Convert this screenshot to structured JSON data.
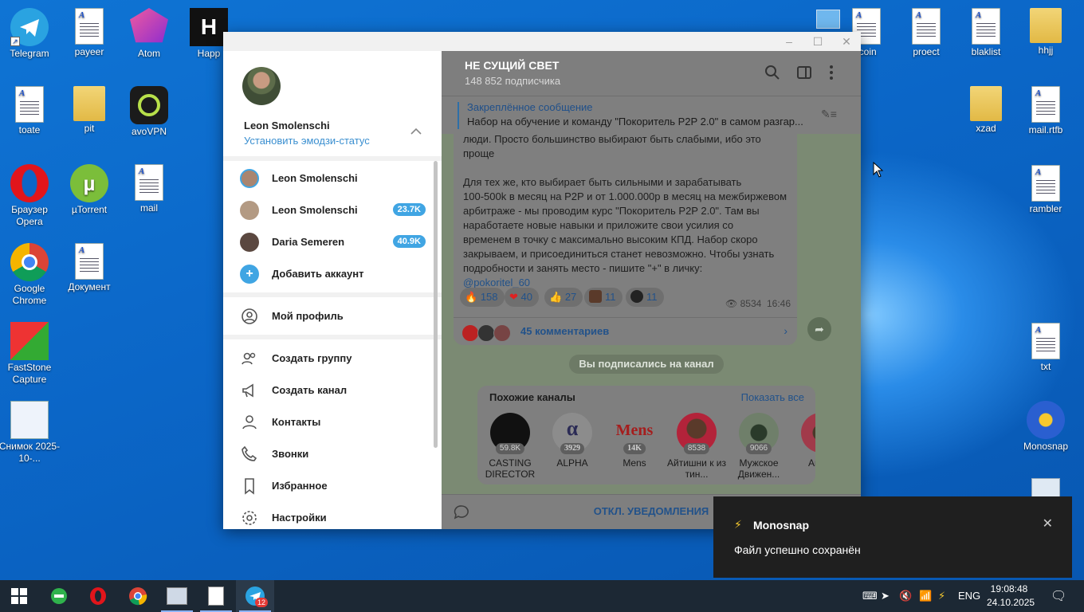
{
  "desktop": {
    "icons_left": [
      {
        "label": "Telegram",
        "icon": "telegram-icon",
        "color": "#2aa3e1"
      },
      {
        "label": "payeer",
        "icon": "document-icon"
      },
      {
        "label": "Atom",
        "icon": "atom-icon",
        "color": "#d03c8a"
      },
      {
        "label": "Happ",
        "icon": "happ-icon"
      },
      {
        "label": "toate",
        "icon": "document-icon"
      },
      {
        "label": "pit",
        "icon": "folder-icon"
      },
      {
        "label": "avoVPN",
        "icon": "vpn-icon"
      },
      {
        "label": "Браузер Opera",
        "icon": "opera-icon",
        "color": "#e1151b"
      },
      {
        "label": "µTorrent",
        "icon": "utorrent-icon",
        "color": "#7bbe3a"
      },
      {
        "label": "mail",
        "icon": "document-icon"
      },
      {
        "label": "Google Chrome",
        "icon": "chrome-icon"
      },
      {
        "label": "Документ",
        "icon": "document-icon"
      },
      {
        "label": "FastStone Capture",
        "icon": "faststone-icon"
      },
      {
        "label": "Снимок 2025-10-...",
        "icon": "screenshot-icon"
      }
    ],
    "icons_right": [
      {
        "label": "tcoin",
        "icon": "document-icon"
      },
      {
        "label": "proect",
        "icon": "document-icon"
      },
      {
        "label": "blaklist",
        "icon": "document-icon"
      },
      {
        "label": "hhjj",
        "icon": "folder-icon"
      },
      {
        "label": "xzad",
        "icon": "folder-icon"
      },
      {
        "label": "mail.rtfb",
        "icon": "document-icon"
      },
      {
        "label": "rambler",
        "icon": "document-icon"
      },
      {
        "label": "txt",
        "icon": "document-icon"
      },
      {
        "label": "Monosnap",
        "icon": "monosnap-icon"
      }
    ]
  },
  "window": {
    "controls": {
      "min": "–",
      "max": "☐",
      "close": "✕"
    }
  },
  "menu": {
    "user_name": "Leon Smolenschi",
    "emoji_status": "Установить эмодзи-статус",
    "accounts": [
      {
        "name": "Leon Smolenschi",
        "badge": ""
      },
      {
        "name": "Leon Smolenschi",
        "badge": "23.7K"
      },
      {
        "name": "Daria Semeren",
        "badge": "40.9K"
      }
    ],
    "add_account": "Добавить аккаунт",
    "my_profile": "Мой профиль",
    "items": [
      "Создать группу",
      "Создать канал",
      "Контакты",
      "Звонки",
      "Избранное",
      "Настройки"
    ]
  },
  "chat": {
    "title": "НЕ СУЩИЙ СВЕТ",
    "subtitle": "148 852 подписчика",
    "pinned_label": "Закреплённое сообщение",
    "pinned_text": "Набор на обучение и команду \"Покоритель P2P 2.0\" в самом разгар...",
    "message_lines": [
      "люди. Просто большинство выбирают быть слабыми, ибо это",
      "проще",
      "",
      "Для тех же, кто выбирает быть сильными и зарабатывать",
      "100-500k в месяц на P2P и от 1.000.000р в месяц на межбиржевом",
      "арбитраже - мы проводим курс \"Покоритель P2P 2.0\". Там вы",
      "наработаете новые навыки и приложите свои усилия со",
      "временем в точку с максимально высоким КПД. Набор скоро",
      "закрываем, и присоединиться станет невозможно. Чтобы узнать",
      "подробности и занять место - пишите \"+\" в личку:"
    ],
    "link": "@pokoritel_60",
    "reactions": [
      {
        "emoji": "🔥",
        "count": "158"
      },
      {
        "emoji": "❤",
        "count": "40"
      },
      {
        "emoji": "👍",
        "count": "27"
      },
      {
        "emoji": "",
        "count": "11"
      },
      {
        "emoji": "",
        "count": "11"
      }
    ],
    "views": "8534",
    "time": "16:46",
    "comments": "45 комментариев",
    "subscribed": "Вы подписались на канал",
    "similar_title": "Похожие каналы",
    "show_all": "Показать все",
    "channels": [
      {
        "name": "CASTING DIRECTOR",
        "count": "59.8K"
      },
      {
        "name": "ALPHA",
        "count": "3929"
      },
      {
        "name": "Mens",
        "count": "14K"
      },
      {
        "name": "Айтишни к из тин...",
        "count": "8538"
      },
      {
        "name": "Мужское Движен...",
        "count": "9066"
      },
      {
        "name": "Анд д",
        "count": ""
      }
    ],
    "mute": "ОТКЛ. УВЕДОМЛЕНИЯ"
  },
  "toast": {
    "title": "Monosnap",
    "message": "Файл успешно сохранён",
    "close": "✕"
  },
  "taskbar": {
    "lang": "ENG",
    "time": "19:08:48",
    "date": "24.10.2025",
    "tg_badge": "12"
  }
}
